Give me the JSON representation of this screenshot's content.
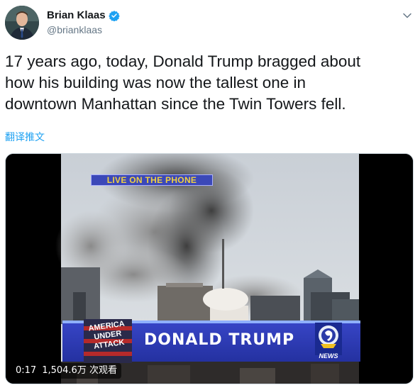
{
  "author": {
    "display_name": "Brian Klaas",
    "handle": "@brianklaas",
    "verified_icon": "verified-badge-icon"
  },
  "tweet": {
    "text": "17 years ago, today, Donald Trump bragged about\nhow his building was now the tallest one in\ndowntown Manhattan since the Twin Towers fell.",
    "translate_label": "翻译推文"
  },
  "video": {
    "banner": "LIVE ON THE PHONE",
    "lower_third_name": "DONALD TRUMP",
    "segment_logo": "AMERICA UNDER ATTACK",
    "station_logo": "NEWS",
    "duration": "0:17",
    "views": "1,504.6万 次观看"
  },
  "colors": {
    "link": "#1da1f2",
    "verified": "#1da1f2",
    "secondary_text": "#657786"
  }
}
